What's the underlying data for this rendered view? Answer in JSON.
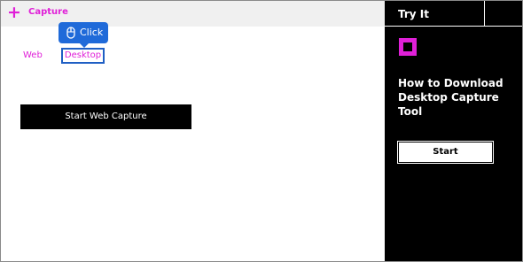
{
  "topbar": {
    "plus_icon": "plus-icon",
    "capture_label": "Capture"
  },
  "tabs": {
    "web_label": "Web",
    "desktop_label": "Desktop"
  },
  "tooltip": {
    "icon": "mouse-icon",
    "label": "Click"
  },
  "main": {
    "start_web_capture_label": "Start Web Capture"
  },
  "panel": {
    "header_label": "Try It",
    "logo_icon": "square-logo-icon",
    "title": "How to Download Desktop Capture Tool",
    "start_label": "Start"
  },
  "colors": {
    "accent": "#e020d8",
    "highlight": "#1f5fc4",
    "panel_bg": "#000000",
    "topbar_bg": "#f0f0f0"
  }
}
